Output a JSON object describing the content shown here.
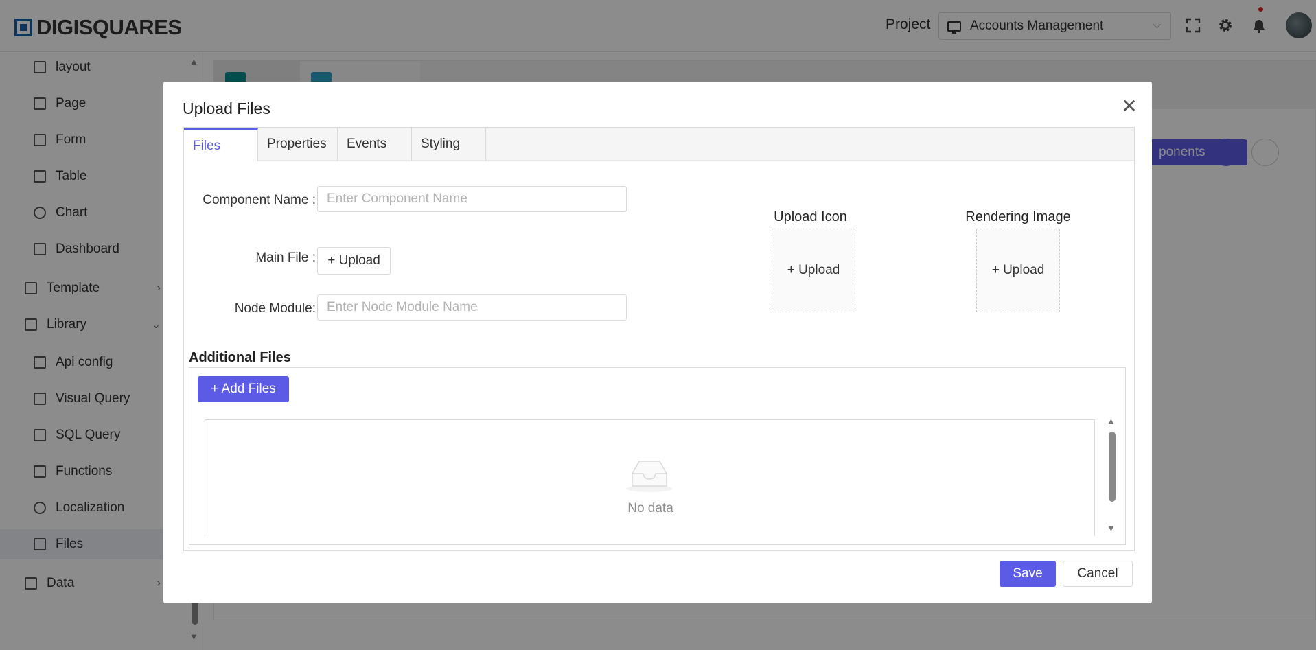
{
  "header": {
    "logo_text": "DIGISQUARES",
    "project_label": "Project",
    "project_value": "Accounts Management"
  },
  "sidebar": {
    "items": [
      {
        "label": "layout"
      },
      {
        "label": "Page"
      },
      {
        "label": "Form"
      },
      {
        "label": "Table"
      },
      {
        "label": "Chart"
      },
      {
        "label": "Dashboard"
      },
      {
        "label": "Template"
      },
      {
        "label": "Library"
      },
      {
        "label": "Api config"
      },
      {
        "label": "Visual Query"
      },
      {
        "label": "SQL Query"
      },
      {
        "label": "Functions"
      },
      {
        "label": "Localization"
      },
      {
        "label": "Files"
      },
      {
        "label": "Data"
      }
    ]
  },
  "background": {
    "components_button_partial": "ponents"
  },
  "modal": {
    "title": "Upload Files",
    "tabs": [
      {
        "label": "Files"
      },
      {
        "label": "Properties"
      },
      {
        "label": "Events"
      },
      {
        "label": "Styling"
      }
    ],
    "component_name_label": "Component Name :",
    "component_name_placeholder": "Enter Component Name",
    "main_file_label": "Main File :",
    "upload_label": "+ Upload",
    "node_module_label": "Node Module:",
    "node_module_placeholder": "Enter Node Module Name",
    "upload_icon_title": "Upload Icon",
    "rendering_image_title": "Rendering Image",
    "additional_files_title": "Additional Files",
    "add_files_label": "+ Add Files",
    "no_data": "No data",
    "save_label": "Save",
    "cancel_label": "Cancel"
  }
}
